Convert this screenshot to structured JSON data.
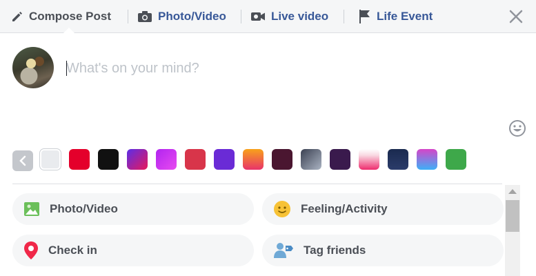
{
  "tabs": [
    {
      "label": "Compose Post",
      "icon": "pencil-icon"
    },
    {
      "label": "Photo/Video",
      "icon": "camera-icon"
    },
    {
      "label": "Live video",
      "icon": "video-camera-icon"
    },
    {
      "label": "Life Event",
      "icon": "flag-icon"
    }
  ],
  "composer": {
    "placeholder": "What's on your mind?",
    "value": ""
  },
  "background_swatches": [
    {
      "name": "plain",
      "fill": "#e9ebee",
      "selected": true
    },
    {
      "name": "red",
      "fill": "#e4002b"
    },
    {
      "name": "black",
      "fill": "#111111"
    },
    {
      "name": "purple-red-gradient",
      "fill": "linear-gradient(135deg,#5b2ee8,#e8185b)"
    },
    {
      "name": "purple-magenta-gradient",
      "fill": "linear-gradient(135deg,#b124f0,#e84bf0)"
    },
    {
      "name": "red-hearts",
      "fill": "#d8354a"
    },
    {
      "name": "purple-hearts",
      "fill": "#6a2bd6"
    },
    {
      "name": "orange-pink-gradient",
      "fill": "linear-gradient(180deg,#f8a21b,#e8336a)"
    },
    {
      "name": "dark-maroon",
      "fill": "#4a1630"
    },
    {
      "name": "gray-slate-gradient",
      "fill": "linear-gradient(135deg,#3b4152,#aab3c2)"
    },
    {
      "name": "dark-purple-stars",
      "fill": "#3a1a4d"
    },
    {
      "name": "pink-gradient",
      "fill": "linear-gradient(180deg,#ffffff,#f9d9e2 30%,#ee2d6e)"
    },
    {
      "name": "navy-city",
      "fill": "linear-gradient(180deg,#1a2a4f,#2b3c6a)"
    },
    {
      "name": "magenta-blue-gradient",
      "fill": "linear-gradient(180deg,#d645c8,#3db0f7)"
    },
    {
      "name": "green-hearts",
      "fill": "#3ea84a"
    }
  ],
  "actions": [
    {
      "label": "Photo/Video",
      "icon": "photo-icon"
    },
    {
      "label": "Feeling/Activity",
      "icon": "smiley-icon"
    },
    {
      "label": "Check in",
      "icon": "location-pin-icon"
    },
    {
      "label": "Tag friends",
      "icon": "tag-friends-icon"
    }
  ],
  "colors": {
    "topbar": "#f5f6f7",
    "link_blue": "#385898",
    "text_gray": "#4b4f56",
    "pill_background": "#f5f6f7"
  }
}
